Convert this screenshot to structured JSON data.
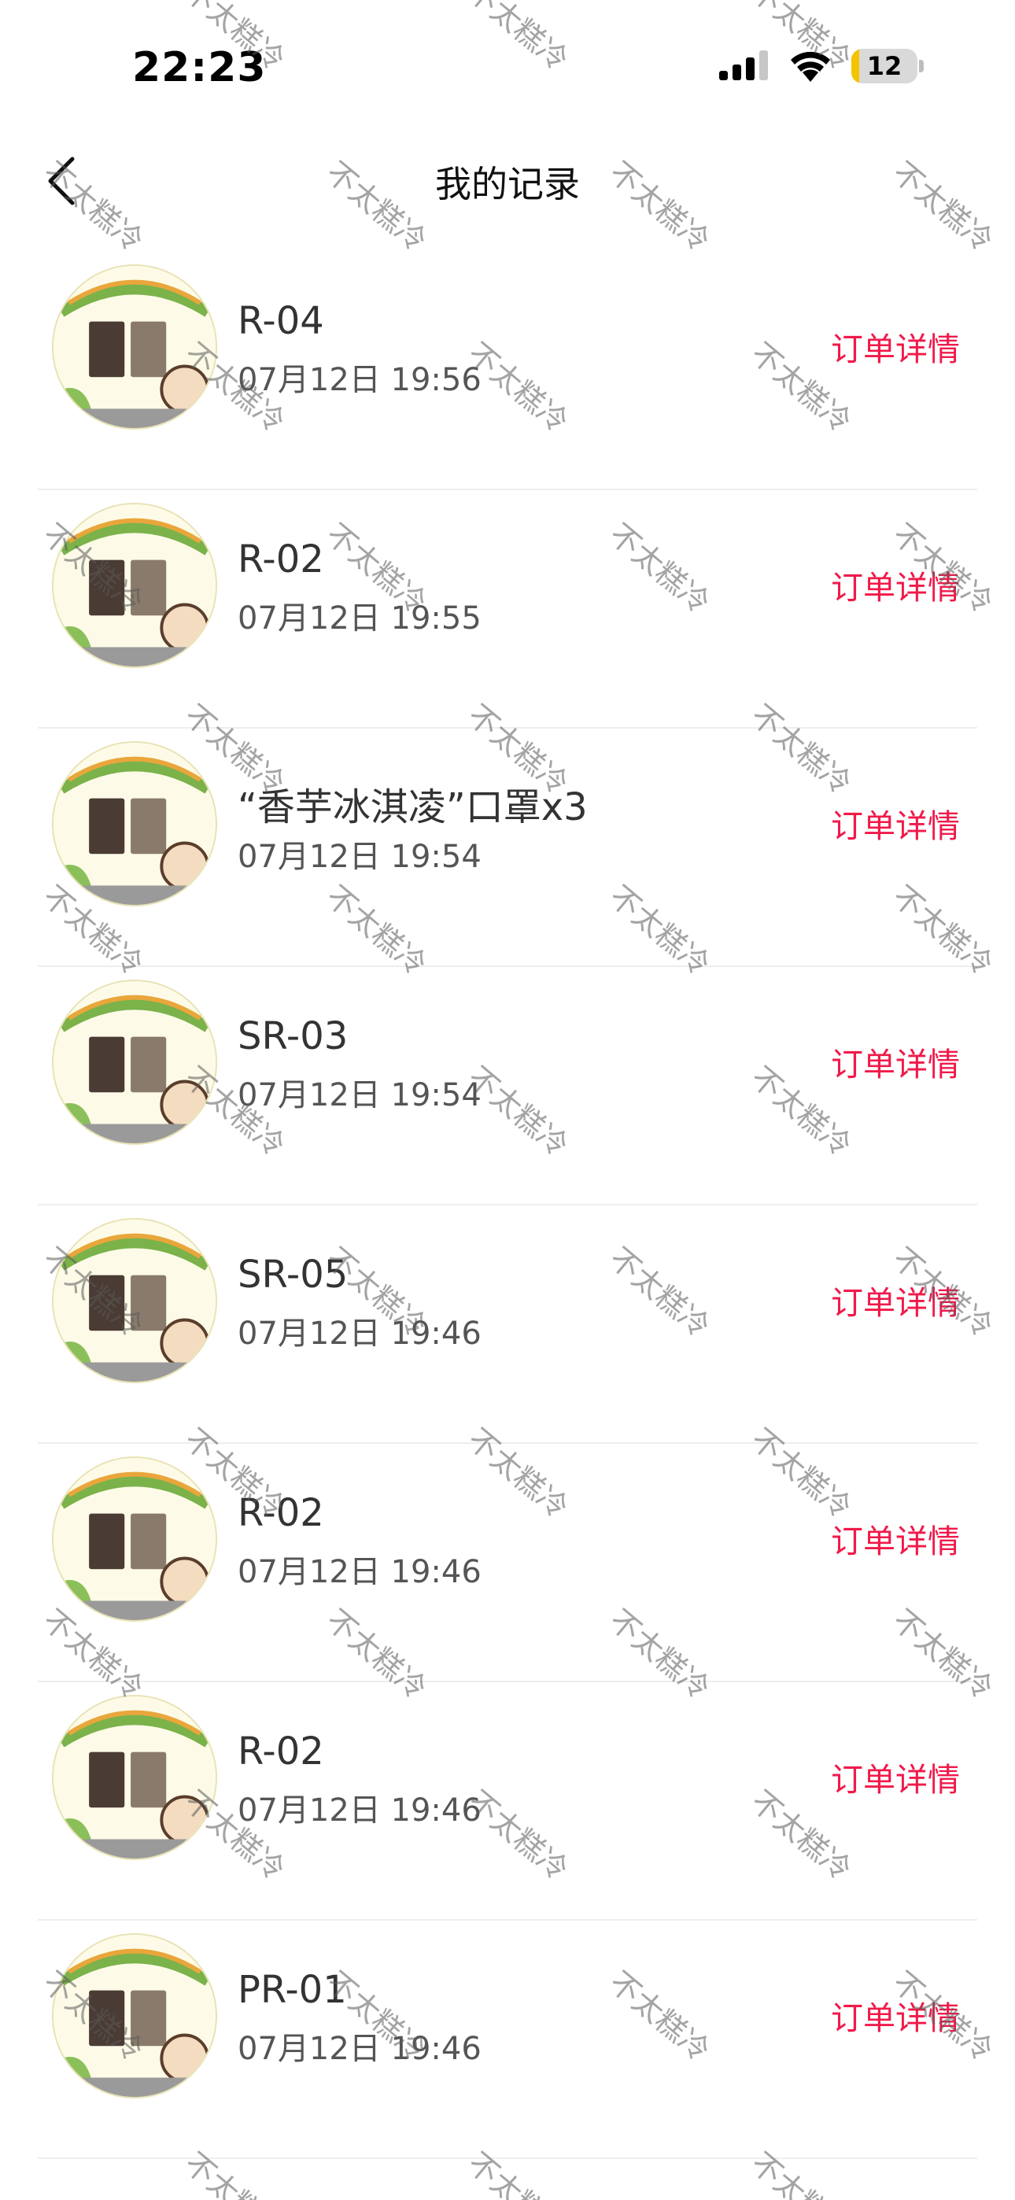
{
  "status_bar": {
    "time": "22:23",
    "battery_level": "12",
    "battery_fraction": 0.12
  },
  "nav": {
    "title": "我的记录",
    "back_icon": "chevron-left-icon"
  },
  "records": [
    {
      "name": "R-04",
      "time": "07月12日 19:56",
      "action": "订单详情"
    },
    {
      "name": "R-02",
      "time": "07月12日 19:55",
      "action": "订单详情"
    },
    {
      "name": "“香芋冰淇凌”口罩x3",
      "time": "07月12日 19:54",
      "action": "订单详情"
    },
    {
      "name": "SR-03",
      "time": "07月12日 19:54",
      "action": "订单详情"
    },
    {
      "name": "SR-05",
      "time": "07月12日 19:46",
      "action": "订单详情"
    },
    {
      "name": "R-02",
      "time": "07月12日 19:46",
      "action": "订单详情"
    },
    {
      "name": "R-02",
      "time": "07月12日 19:46",
      "action": "订单详情"
    },
    {
      "name": "PR-01",
      "time": "07月12日 19:46",
      "action": "订单详情"
    }
  ],
  "watermark": {
    "text": "不太糕冷"
  },
  "colors": {
    "accent": "#f01a4a",
    "battery": "#f4c400"
  }
}
